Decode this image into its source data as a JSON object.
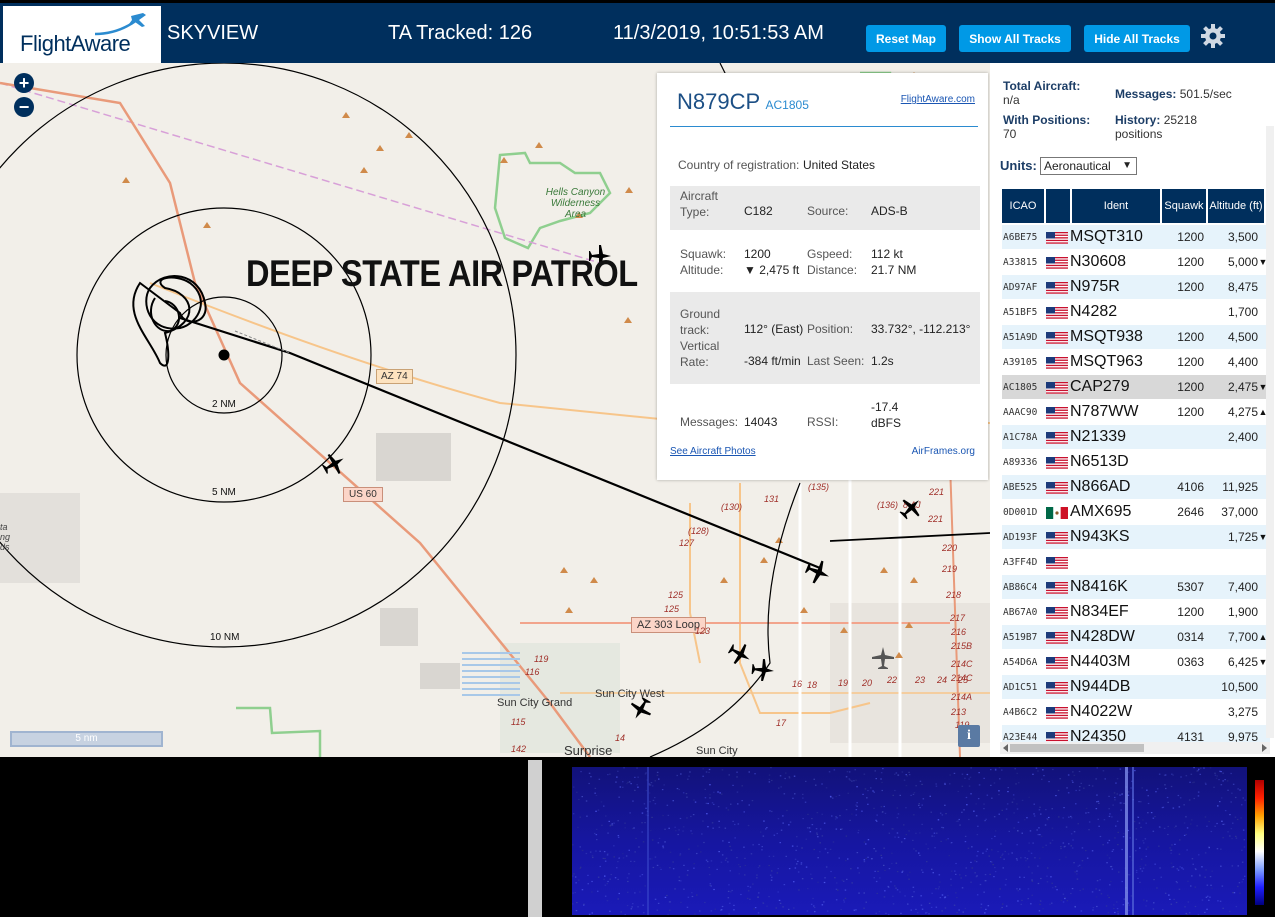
{
  "header": {
    "logo_text": "FlightAware",
    "app_title": "SKYVIEW",
    "tracked_label": "TA Tracked: 126",
    "clock": "11/3/2019, 10:51:53 AM",
    "buttons": {
      "reset": "Reset Map",
      "show_all": "Show All Tracks",
      "hide_all": "Hide All Tracks"
    }
  },
  "map": {
    "zoom_in": "+",
    "zoom_out": "−",
    "watermark": "DEEP STATE AIR PATROL",
    "ring_labels": [
      "2 NM",
      "5 NM",
      "10 NM"
    ],
    "place_labels": {
      "hells_canyon": [
        "Hells Canyon",
        "Wilderness",
        "Area"
      ],
      "sun_city_grand": "Sun City Grand",
      "sun_city_west": "Sun City West",
      "sun_city": "Sun City",
      "surprise": "Surprise",
      "left_edge": [
        "ta",
        "ng",
        "ds"
      ]
    },
    "road_labels": {
      "az74": "AZ 74",
      "us60": "US 60",
      "az303": "AZ 303 Loop"
    },
    "route_numbers": [
      "131",
      "(135)",
      "(130)",
      "(128)",
      "127",
      "125",
      "125",
      "123",
      "221",
      "(136)",
      "8 AJ",
      "221",
      "220",
      "219",
      "218",
      "217",
      "216",
      "215B",
      "214C",
      "214C",
      "214A",
      "213",
      "119",
      "119",
      "116",
      "115",
      "142",
      "14",
      "17",
      "16",
      "18",
      "19",
      "20",
      "22",
      "23",
      "24",
      "25"
    ],
    "scale_label": "5 nm",
    "info_label": "i"
  },
  "popup": {
    "registration": "N879CP",
    "icao": "AC1805",
    "flightaware_link": "FlightAware.com",
    "country_label": "Country of registration:",
    "country_value": "United States",
    "aircraft_type_label": [
      "Aircraft",
      "Type:"
    ],
    "aircraft_type_value": "C182",
    "source_label": "Source:",
    "source_value": "ADS-B",
    "squawk_label": "Squawk:",
    "squawk_value": "1200",
    "gspeed_label": "Gspeed:",
    "gspeed_value": "112 kt",
    "altitude_label": "Altitude:",
    "altitude_value": "▼ 2,475 ft",
    "distance_label": "Distance:",
    "distance_value": "21.7 NM",
    "ground_track_label": [
      "Ground",
      "track:"
    ],
    "ground_track_value": "112° (East)",
    "position_label": "Position:",
    "position_value": "33.732°, -112.213°",
    "vertical_rate_label": [
      "Vertical",
      "Rate:"
    ],
    "vertical_rate_value": "-384 ft/min",
    "last_seen_label": "Last Seen:",
    "last_seen_value": "1.2s",
    "messages_label": "Messages:",
    "messages_value": "14043",
    "rssi_label": "RSSI:",
    "rssi_value": [
      "-17.4",
      "dBFS"
    ],
    "photos_link": "See Aircraft Photos",
    "airframes_link": "AirFrames.org"
  },
  "panel": {
    "total_aircraft_label": "Total Aircraft:",
    "total_aircraft_value": "n/a",
    "with_positions_label": "With Positions:",
    "with_positions_value": "70",
    "messages_label": "Messages:",
    "messages_value": "501.5/sec",
    "history_label": "History:",
    "history_value": "25218",
    "history_unit": "positions",
    "units_label": "Units:",
    "units_value": "Aeronautical",
    "columns": [
      "ICAO",
      "",
      "Ident",
      "Squawk",
      "Altitude (ft)"
    ],
    "rows": [
      {
        "icao": "A6BE75",
        "flag": "us",
        "ident": "MSQT310",
        "squawk": "1200",
        "alt": "3,500",
        "vr": ""
      },
      {
        "icao": "A33815",
        "flag": "us",
        "ident": "N30608",
        "squawk": "1200",
        "alt": "5,000",
        "vr": "▼"
      },
      {
        "icao": "AD97AF",
        "flag": "us",
        "ident": "N975R",
        "squawk": "1200",
        "alt": "8,475",
        "vr": ""
      },
      {
        "icao": "A51BF5",
        "flag": "us",
        "ident": "N4282",
        "squawk": "",
        "alt": "1,700",
        "vr": ""
      },
      {
        "icao": "A51A9D",
        "flag": "us",
        "ident": "MSQT938",
        "squawk": "1200",
        "alt": "4,500",
        "vr": ""
      },
      {
        "icao": "A39105",
        "flag": "us",
        "ident": "MSQT963",
        "squawk": "1200",
        "alt": "4,400",
        "vr": ""
      },
      {
        "icao": "AC1805",
        "flag": "us",
        "ident": "CAP279",
        "squawk": "1200",
        "alt": "2,475",
        "vr": "▼",
        "selected": true
      },
      {
        "icao": "AAAC90",
        "flag": "us",
        "ident": "N787WW",
        "squawk": "1200",
        "alt": "4,275",
        "vr": "▲"
      },
      {
        "icao": "A1C78A",
        "flag": "us",
        "ident": "N21339",
        "squawk": "",
        "alt": "2,400",
        "vr": ""
      },
      {
        "icao": "A89336",
        "flag": "us",
        "ident": "N6513D",
        "squawk": "",
        "alt": "",
        "vr": ""
      },
      {
        "icao": "ABE525",
        "flag": "us",
        "ident": "N866AD",
        "squawk": "4106",
        "alt": "11,925",
        "vr": ""
      },
      {
        "icao": "0D001D",
        "flag": "mx",
        "ident": "AMX695",
        "squawk": "2646",
        "alt": "37,000",
        "vr": ""
      },
      {
        "icao": "AD193F",
        "flag": "us",
        "ident": "N943KS",
        "squawk": "",
        "alt": "1,725",
        "vr": "▼"
      },
      {
        "icao": "A3FF4D",
        "flag": "us",
        "ident": "",
        "squawk": "",
        "alt": "",
        "vr": ""
      },
      {
        "icao": "AB86C4",
        "flag": "us",
        "ident": "N8416K",
        "squawk": "5307",
        "alt": "7,400",
        "vr": ""
      },
      {
        "icao": "AB67A0",
        "flag": "us",
        "ident": "N834EF",
        "squawk": "1200",
        "alt": "1,900",
        "vr": ""
      },
      {
        "icao": "A519B7",
        "flag": "us",
        "ident": "N428DW",
        "squawk": "0314",
        "alt": "7,700",
        "vr": "▲"
      },
      {
        "icao": "A54D6A",
        "flag": "us",
        "ident": "N4403M",
        "squawk": "0363",
        "alt": "6,425",
        "vr": "▼"
      },
      {
        "icao": "AD1C51",
        "flag": "us",
        "ident": "N944DB",
        "squawk": "",
        "alt": "10,500",
        "vr": ""
      },
      {
        "icao": "A4B6C2",
        "flag": "us",
        "ident": "N4022W",
        "squawk": "",
        "alt": "3,275",
        "vr": ""
      },
      {
        "icao": "A23E44",
        "flag": "us",
        "ident": "N24350",
        "squawk": "4131",
        "alt": "9,975",
        "vr": ""
      }
    ]
  },
  "colors": {
    "header_bg": "#002f5d",
    "button_bg": "#0099e6",
    "row_tint": "#e6f3fb",
    "selected_row": "#d8d8d8"
  }
}
